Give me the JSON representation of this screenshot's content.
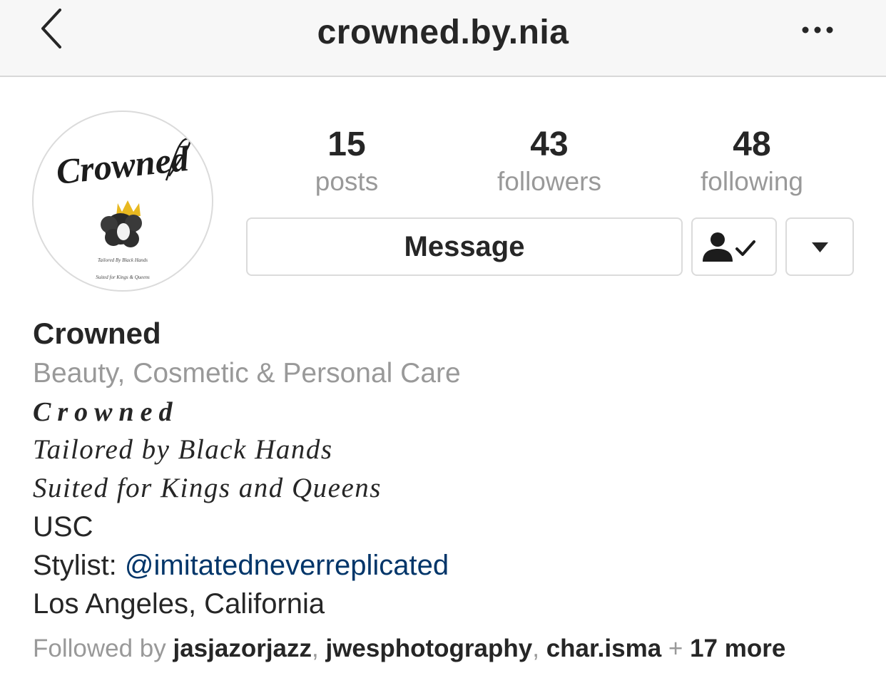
{
  "header": {
    "title": "crowned.by.nia",
    "back_icon": "chevron-left-icon",
    "more_icon": "ellipsis-icon"
  },
  "profile": {
    "avatar": {
      "logo_text": "Crowned",
      "line1": "Tailored By Black Hands",
      "line2": "Suited for Kings & Queens",
      "crown_color": "#e8b820"
    },
    "stats": {
      "posts": {
        "value": "15",
        "label": "posts"
      },
      "followers": {
        "value": "43",
        "label": "followers"
      },
      "following": {
        "value": "48",
        "label": "following"
      }
    },
    "actions": {
      "message_label": "Message",
      "following_icon": "person-check-icon",
      "dropdown_icon": "caret-down-icon"
    }
  },
  "bio": {
    "name": "Crowned",
    "category": "Beauty, Cosmetic & Personal Care",
    "script_title": "Crowned",
    "tagline1": "Tailored by Black Hands",
    "tagline2": "Suited for Kings and Queens",
    "school": "USC",
    "stylist_prefix": "Stylist: ",
    "stylist_handle": "@imitatedneverreplicated",
    "location": "Los Angeles, California"
  },
  "followed_by": {
    "prefix": "Followed by ",
    "users": [
      "jasjazorjazz",
      "jwesphotography",
      "char.isma"
    ],
    "separator": ", ",
    "plus": " + ",
    "more": "17 more"
  },
  "colors": {
    "text": "#262626",
    "secondary": "#999999",
    "link": "#003569",
    "border": "#dbdbdb",
    "header_bg": "#f7f7f7"
  }
}
